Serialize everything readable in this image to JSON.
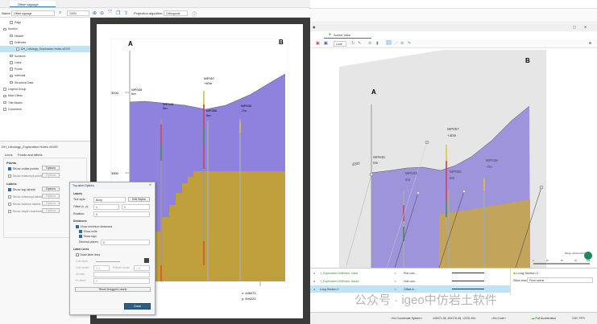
{
  "left_window": {
    "tab": "Offset signage",
    "toolbar": {
      "name_label": "Name:",
      "name_value": "Offset signage",
      "zoom": "100%",
      "projection_label": "Projection algorithm:",
      "projection_value": "Orthogonal"
    },
    "tree": [
      {
        "label": "Page",
        "indent": 1
      },
      {
        "label": "Section",
        "indent": 0
      },
      {
        "label": "Header",
        "indent": 1
      },
      {
        "label": "Drillholes",
        "indent": 1
      },
      {
        "label": "DH_Lithology_Exploration Holes v0100",
        "indent": 2,
        "selected": true
      },
      {
        "label": "Surfaces",
        "indent": 1
      },
      {
        "label": "Lines",
        "indent": 1
      },
      {
        "label": "Points",
        "indent": 1
      },
      {
        "label": "Intervals",
        "indent": 1
      },
      {
        "label": "Structural Data",
        "indent": 1
      },
      {
        "label": "Legend Group",
        "indent": 0
      },
      {
        "label": "Main Views",
        "indent": 0
      },
      {
        "label": "Title Blocks",
        "indent": 0
      },
      {
        "label": "Comments",
        "indent": 0
      }
    ],
    "props": {
      "title": "DH_Lithology_Exploration Holes v0100",
      "tabs": [
        "Lines",
        "Points and labels"
      ],
      "points_heading": "Points",
      "points": [
        {
          "label": "Show collar points",
          "checked": true
        },
        {
          "label": "Show intercept points",
          "checked": false
        }
      ],
      "labels_heading": "Labels",
      "labels": [
        {
          "label": "Show top labels",
          "checked": true
        },
        {
          "label": "Show intercept labels",
          "checked": false
        },
        {
          "label": "Show bottom labels",
          "checked": false
        },
        {
          "label": "Show depth markers",
          "checked": false
        }
      ],
      "options_label": "Options"
    }
  },
  "section": {
    "a": "A",
    "b": "B",
    "elev_labels": [
      "3200",
      "3000"
    ],
    "holes": [
      {
        "name": "WP045",
        "offset": "0m"
      },
      {
        "name": "WP043",
        "offset": "0m"
      },
      {
        "name": "WP057",
        "offset": "+40m"
      },
      {
        "name": "WP050",
        "offset": "0m"
      },
      {
        "name": "WP049",
        "offset": "-7m"
      }
    ],
    "coord_x": "x: 445072",
    "coord_y": "y: 494222",
    "colors": {
      "upper": "#8f82de",
      "lower": "#bfa03c"
    }
  },
  "dialog": {
    "title": "Top label Options",
    "labels_heading": "Labels",
    "text_style_label": "Text style:",
    "text_style": "Body",
    "edit_styles": "Edit Styles",
    "offset_label": "Offset (x, y):",
    "offset_x": "1",
    "offset_y": "1",
    "rotation_label": "Rotation:",
    "rotation": "0",
    "distances_heading": "Distances",
    "show_min": "Show minimum distances",
    "show_units": "Show units",
    "show_sign": "Show sign",
    "decimal_label": "Decimal places:",
    "decimal": "0",
    "label_lines_heading": "Label Lines",
    "draw_lines": "Draw label lines",
    "line_style": "Line style:",
    "line_width": "Line width:",
    "line_width_value": "0.3",
    "pattern_scale": "Pattern scale:",
    "pattern_scale_value": "1.0",
    "arrows": "Arrows:",
    "h_offset": "H offset:",
    "h_offset_value": "0",
    "reset": "Reset Dragged Labels",
    "close": "Close"
  },
  "right_window": {
    "tab": "Scene View",
    "toolbar_mode": "Look",
    "scene": {
      "a": "A",
      "b": "B",
      "elev": "3200",
      "holes": [
        {
          "name": "WP045",
          "offset": "0m"
        },
        {
          "name": "WP043",
          "offset": "0m"
        },
        {
          "name": "WP057",
          "offset": "+40m"
        },
        {
          "name": "WP050",
          "offset": "0m"
        },
        {
          "name": "WP049",
          "offset": "-7m"
        }
      ],
      "scale_ticks": [
        "0",
        "25",
        "50",
        "75",
        "100"
      ],
      "compass": "Plunge +15 Azimuth 016"
    },
    "layers": [
      {
        "name": "1_Exploration Drillholes: collar",
        "style": "Plot colo..."
      },
      {
        "name": "1_Exploration Drillholes: traces",
        "style": "Holl colo..."
      },
      {
        "name": "Long Section 2",
        "style": "Offset si...",
        "selected": true
      }
    ],
    "layer_props": {
      "title": "Long Section 2",
      "slice_label": "Slice mode:",
      "slice_value": "From scene"
    },
    "status": {
      "crs": "<No Coordinate System>",
      "coords": "445071.36, 494176.45, <2231.54>",
      "code": "<No Code>",
      "accel": "Full Acceleration",
      "fps": "100+ FPS"
    }
  },
  "watermark": "公众号 · igeo中仿岩土软件"
}
